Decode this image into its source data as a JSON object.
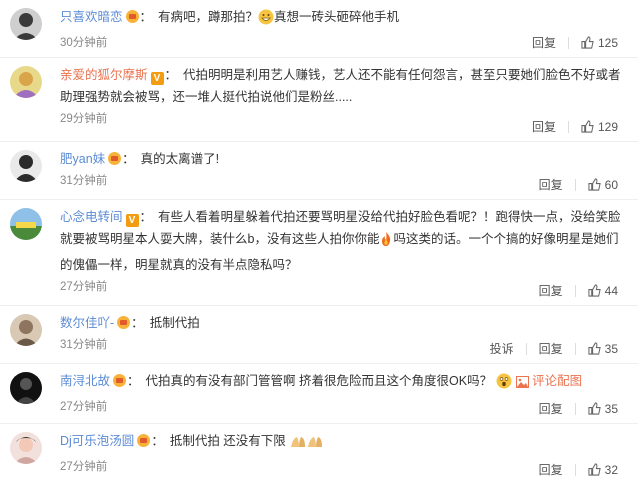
{
  "actions": {
    "reply": "回复",
    "report": "投诉"
  },
  "comments": [
    {
      "user": "只喜欢暗恋",
      "pre": "有病吧，蹲那拍？",
      "post": "真想一砖头砸碎他手机",
      "time": "30分钟前",
      "likes": "125",
      "avatar_color": "#3a3a3a",
      "badge": "vip",
      "emoji": "grin"
    },
    {
      "user": "亲爱的狐尔摩斯",
      "text": "代拍明明是利用艺人赚钱，艺人还不能有任何怨言，甚至只要她们脸色不好或者助理强势就会被骂，还一堆人挺代拍说他们是粉丝.....",
      "time": "29分钟前",
      "likes": "129",
      "avatar_color": "#d9c260",
      "badge": "v"
    },
    {
      "user": "肥yan妹",
      "text": "真的太离谱了!",
      "time": "31分钟前",
      "likes": "60",
      "avatar_color": "#2b2b2b",
      "badge": "vip"
    },
    {
      "user": "心念电转间",
      "pre": "有些人看着明星躲着代拍还要骂明星没给代拍好脸色看呢？！跑得快一点，没给笑脸就要被骂明星本人耍大牌，装什么b，没有这些人拍你你能",
      "post": "吗这类的话。一个个搞的好像明星是她们的傀儡一样，明星就真的没有半点隐私吗？",
      "time": "27分钟前",
      "likes": "44",
      "avatar_color": "#4a8a3a",
      "badge": "v",
      "emoji": "fire"
    },
    {
      "user": "数尔佳吖-",
      "text": "抵制代拍",
      "time": "31分钟前",
      "likes": "35",
      "avatar_color": "#b9a58e",
      "badge": "vip"
    },
    {
      "user": "南浔北故",
      "text": "代拍真的有没有部门管管啊 挤着很危险而且这个角度很OK吗？",
      "time": "27分钟前",
      "likes": "35",
      "avatar_color": "#222222",
      "badge": "vip",
      "emoji": "wow",
      "piclink": "评论配图"
    },
    {
      "user": "Dj可乐泡汤圆",
      "text": "抵制代拍 还没有下限",
      "time": "27分钟前",
      "likes": "32",
      "avatar_color": "#cfa7a0",
      "badge": "vip",
      "emoji": "hands"
    }
  ]
}
